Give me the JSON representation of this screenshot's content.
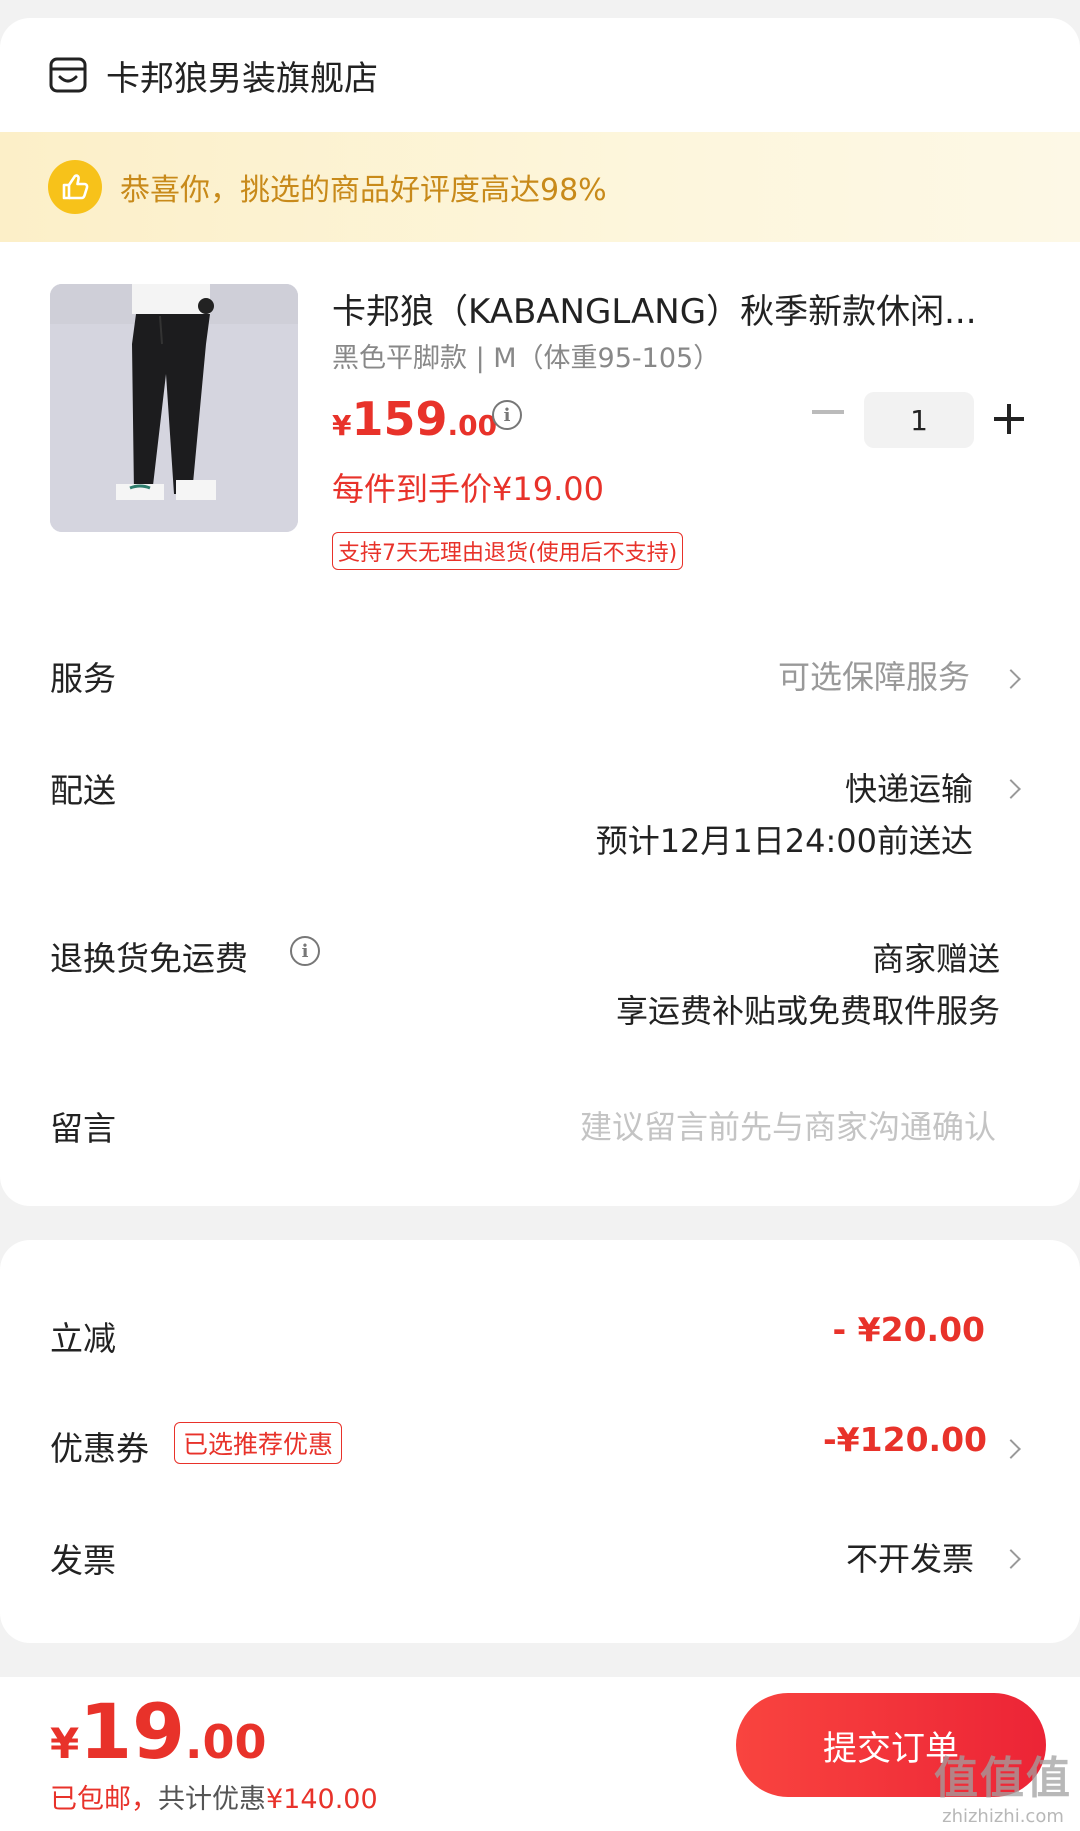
{
  "shop": {
    "icon": "shop-icon",
    "name": "卡邦狼男装旗舰店"
  },
  "banner": {
    "icon": "thumbs-up-icon",
    "text": "恭喜你，挑选的商品好评度高达98%"
  },
  "product": {
    "title": "卡邦狼（KABANGLANG）秋季新款休闲...",
    "spec": "黑色平脚款 | M（体重95-105）",
    "price_currency": "¥",
    "price_int": "159",
    "price_dec": ".00",
    "quantity": "1",
    "deal_price": "每件到手价¥19.00",
    "return_tag": "支持7天无理由退货(使用后不支持)"
  },
  "service": {
    "label": "服务",
    "value": "可选保障服务"
  },
  "delivery": {
    "label": "配送",
    "method": "快递运输",
    "eta": "预计12月1日24:00前送达"
  },
  "return_shipping": {
    "label": "退换货免运费",
    "value": "商家赠送",
    "detail": "享运费补贴或免费取件服务"
  },
  "message": {
    "label": "留言",
    "placeholder": "建议留言前先与商家沟通确认"
  },
  "discount": {
    "label": "立减",
    "value": "- ¥20.00"
  },
  "coupon": {
    "label": "优惠券",
    "tag": "已选推荐优惠",
    "value": "-¥120.00"
  },
  "invoice": {
    "label": "发票",
    "value": "不开发票"
  },
  "bottom": {
    "total_currency": "¥",
    "total_int": "19",
    "total_dec": ".00",
    "shipping_note": "已包邮，",
    "savings_prefix": "共计优惠",
    "savings_value": "¥140.00",
    "submit_label": "提交订单"
  },
  "watermark": {
    "line1": "值值值",
    "line2": "zhizhizhi.com"
  },
  "colors": {
    "accent": "#e8322a",
    "banner_text": "#c88a1a",
    "banner_icon": "#f7c21a"
  }
}
